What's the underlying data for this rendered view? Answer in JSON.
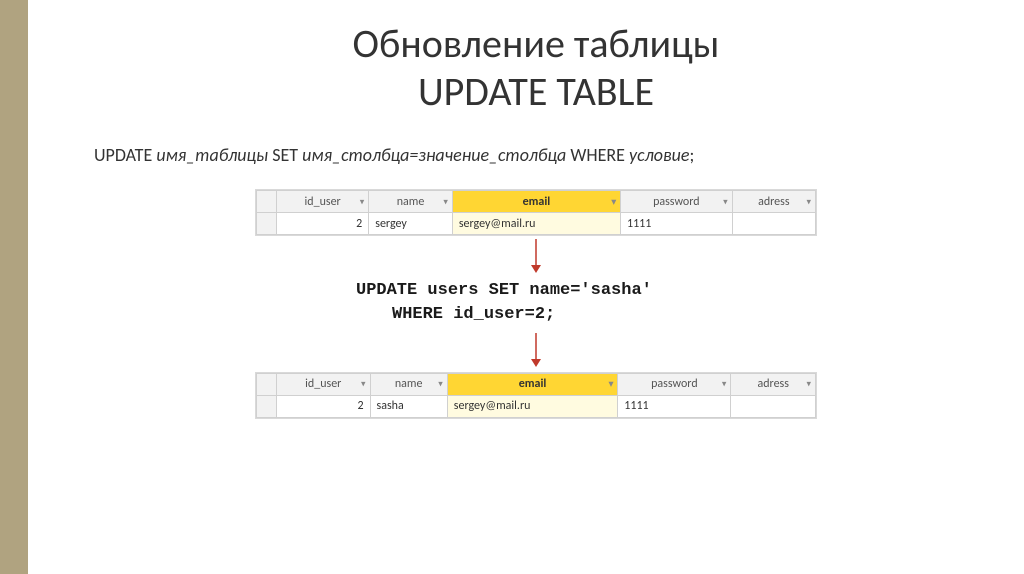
{
  "title_line1": "Обновление таблицы",
  "title_line2": "UPDATE TABLE",
  "syntax": {
    "kw1": "UPDATE",
    "p1": "имя_таблицы",
    "kw2": "SET",
    "p2": "имя_столбца=значение_столбца",
    "kw3": "WHERE",
    "p3": "условие",
    "end": ";"
  },
  "columns": {
    "id_user": "id_user",
    "name": "name",
    "email": "email",
    "password": "password",
    "adress": "adress"
  },
  "table_before": {
    "row": {
      "id_user": "2",
      "name": "sergey",
      "email": "sergey@mail.ru",
      "password": "1111",
      "adress": ""
    }
  },
  "sql_line1": "UPDATE users SET name='sasha'",
  "sql_line2": "WHERE id_user=2;",
  "table_after": {
    "row": {
      "id_user": "2",
      "name": "sasha",
      "email": "sergey@mail.ru",
      "password": "1111",
      "adress": ""
    }
  },
  "colors": {
    "accent_border": "#b0a380",
    "highlight_header": "#ffd633",
    "arrow": "#c0392b"
  }
}
